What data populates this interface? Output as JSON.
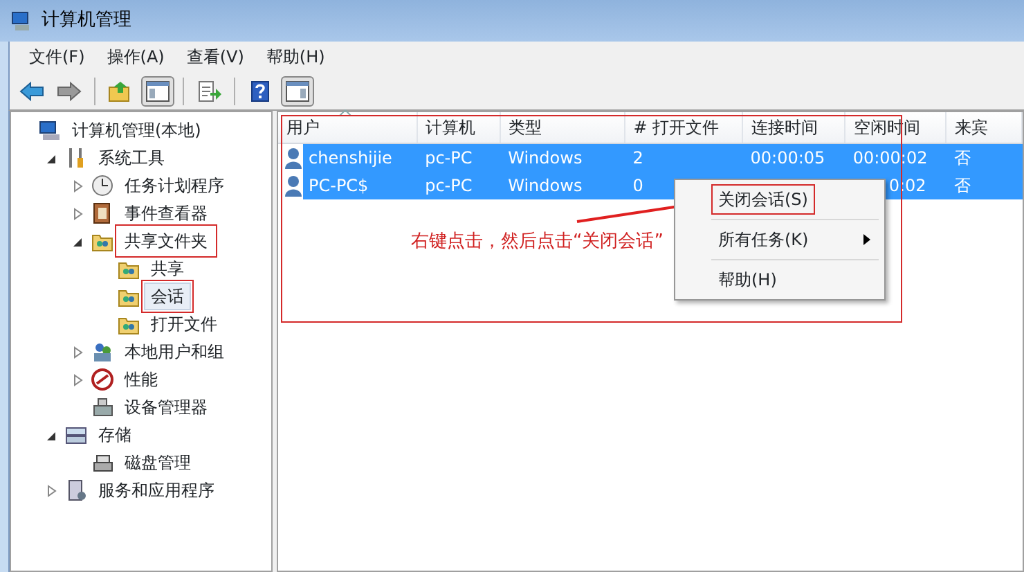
{
  "window": {
    "title": "计算机管理"
  },
  "menu_bar": [
    "文件(F)",
    "操作(A)",
    "查看(V)",
    "帮助(H)"
  ],
  "tree": [
    {
      "label": "计算机管理(本地)",
      "selected": false,
      "annotated": false,
      "children": [
        {
          "label": "系统工具",
          "expanded": true,
          "selected": false,
          "annotated": false,
          "children": [
            {
              "label": "任务计划程序",
              "expanded": false,
              "selected": false,
              "annotated": false
            },
            {
              "label": "事件查看器",
              "expanded": false,
              "selected": false,
              "annotated": false
            },
            {
              "label": "共享文件夹",
              "expanded": true,
              "selected": false,
              "annotated": true,
              "children": [
                {
                  "label": "共享",
                  "selected": false,
                  "annotated": false
                },
                {
                  "label": "会话",
                  "selected": true,
                  "annotated": true
                },
                {
                  "label": "打开文件",
                  "selected": false,
                  "annotated": false
                }
              ]
            },
            {
              "label": "本地用户和组",
              "expanded": false,
              "selected": false,
              "annotated": false
            },
            {
              "label": "性能",
              "expanded": false,
              "selected": false,
              "annotated": false
            },
            {
              "label": "设备管理器",
              "selected": false,
              "annotated": false
            }
          ]
        },
        {
          "label": "存储",
          "expanded": true,
          "selected": false,
          "annotated": false,
          "children": [
            {
              "label": "磁盘管理",
              "selected": false,
              "annotated": false
            }
          ]
        },
        {
          "label": "服务和应用程序",
          "expanded": false,
          "selected": false,
          "annotated": false
        }
      ]
    }
  ],
  "table": {
    "annotated": true,
    "columns": [
      {
        "label": "用户",
        "sorted": true
      },
      {
        "label": "计算机",
        "sorted": false
      },
      {
        "label": "类型",
        "sorted": false
      },
      {
        "label": "# 打开文件",
        "sorted": false
      },
      {
        "label": "连接时间",
        "sorted": false
      },
      {
        "label": "空闲时间",
        "sorted": false
      },
      {
        "label": "来宾",
        "sorted": false
      }
    ],
    "rows": [
      {
        "selected": true,
        "cells": [
          "chenshijie",
          "pc-PC",
          "Windows",
          "2",
          "00:00:05",
          "00:00:02",
          "否"
        ]
      },
      {
        "selected": true,
        "cells": [
          "PC-PC$",
          "pc-PC",
          "Windows",
          "0",
          null,
          "0:02",
          "否"
        ]
      }
    ]
  },
  "context_menu": [
    {
      "label": "关闭会话(S)",
      "kind": "item",
      "annotated": true
    },
    {
      "label": "所有任务(K)",
      "kind": "submenu",
      "annotated": false
    },
    {
      "label": "帮助(H)",
      "kind": "item",
      "annotated": false
    }
  ],
  "annotation": {
    "text": "右键点击，然后点击“关闭会话”"
  }
}
